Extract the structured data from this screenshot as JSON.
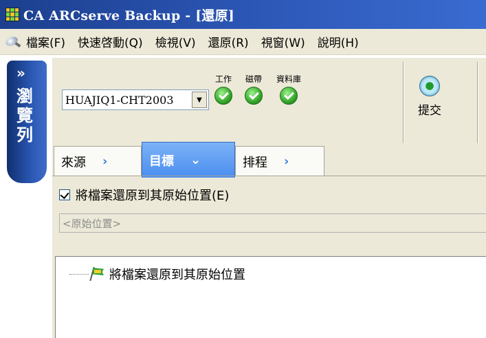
{
  "window": {
    "title": "CA ARCserve Backup - [還原]"
  },
  "menu": {
    "icon": "magnifier-icon",
    "items": [
      "檔案(F)",
      "快速啓動(Q)",
      "檢視(V)",
      "還原(R)",
      "視窗(W)",
      "說明(H)"
    ]
  },
  "browse_bar": {
    "label": "瀏覽列",
    "chevron": "»"
  },
  "toolbar": {
    "server": "HUAJIQ1-CHT2003",
    "status": [
      {
        "label": "工作",
        "icon": "check-icon"
      },
      {
        "label": "磁帶",
        "icon": "check-icon"
      },
      {
        "label": "資料庫",
        "icon": "check-icon"
      }
    ],
    "submit_label": "提交"
  },
  "tabs": [
    {
      "label": "來源",
      "arrow": "›",
      "active": false
    },
    {
      "label": "目標",
      "arrow": "⌄",
      "active": true
    },
    {
      "label": "排程",
      "arrow": "›",
      "active": false
    }
  ],
  "destination": {
    "checkbox_label": "將檔案還原到其原始位置(E)",
    "checked": true,
    "path_placeholder": "<原始位置>",
    "tree_item": "將檔案還原到其原始位置"
  },
  "colors": {
    "title_bar": "#2d58b8",
    "active_tab": "#4a8ef0",
    "status_ok": "#34a62b"
  }
}
